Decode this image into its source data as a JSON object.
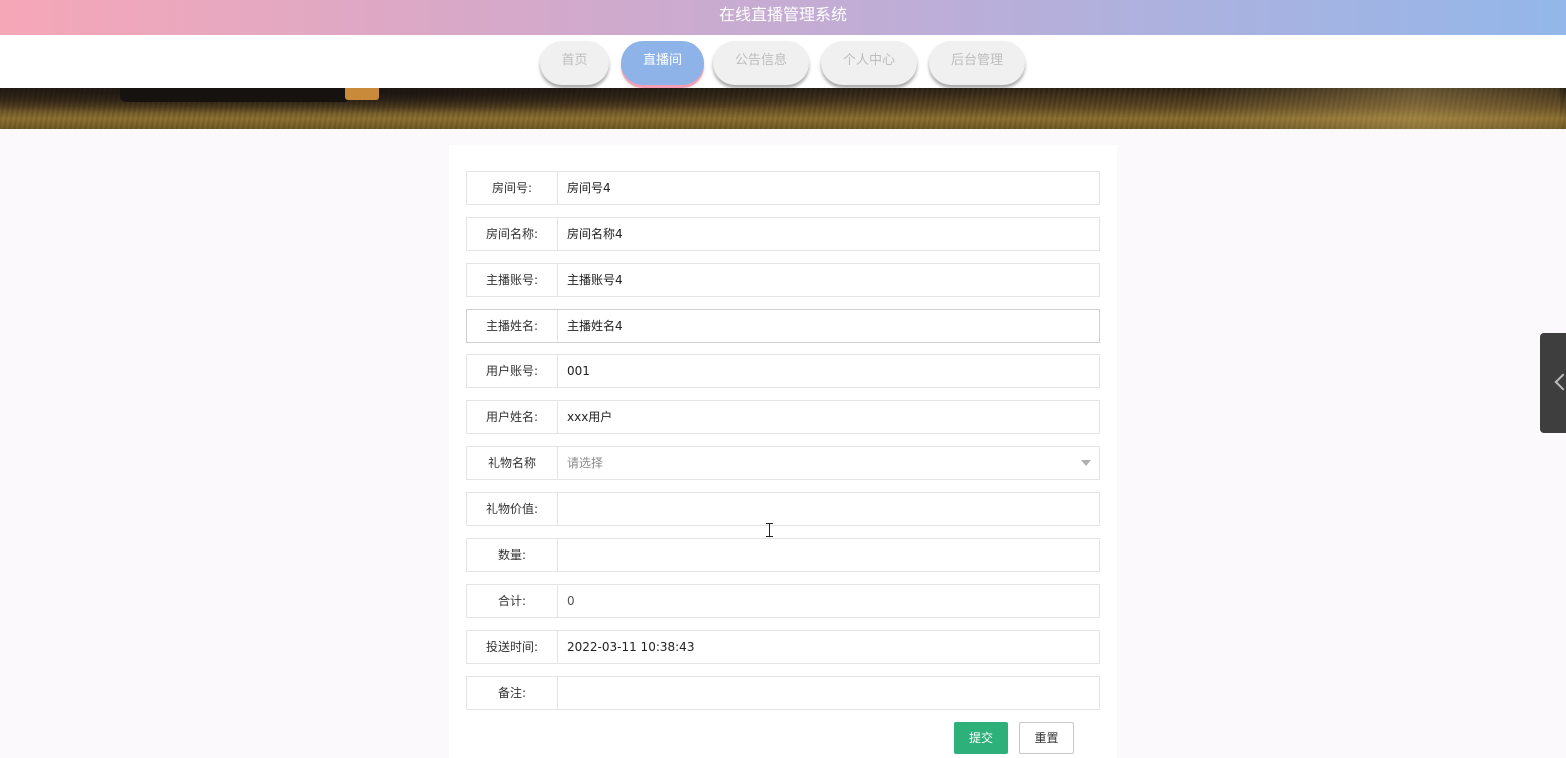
{
  "app": {
    "title": "在线直播管理系统"
  },
  "nav": {
    "items": [
      {
        "label": "首页",
        "active": false
      },
      {
        "label": "直播间",
        "active": true
      },
      {
        "label": "公告信息",
        "active": false
      },
      {
        "label": "个人中心",
        "active": false
      },
      {
        "label": "后台管理",
        "active": false
      }
    ]
  },
  "form": {
    "fields": [
      {
        "label": "房间号:",
        "value": "房间号4"
      },
      {
        "label": "房间名称:",
        "value": "房间名称4"
      },
      {
        "label": "主播账号:",
        "value": "主播账号4"
      },
      {
        "label": "主播姓名:",
        "value": "主播姓名4"
      },
      {
        "label": "用户账号:",
        "value": "001"
      },
      {
        "label": "用户姓名:",
        "value": "xxx用户"
      },
      {
        "label": "礼物名称",
        "value": "",
        "placeholder": "请选择",
        "type": "select"
      },
      {
        "label": "礼物价值:",
        "value": ""
      },
      {
        "label": "数量:",
        "value": ""
      },
      {
        "label": "合计:",
        "value": "0"
      },
      {
        "label": "投送时间:",
        "value": "2022-03-11 10:38:43"
      },
      {
        "label": "备注:",
        "value": ""
      }
    ],
    "submit_label": "提交",
    "reset_label": "重置"
  },
  "colors": {
    "header_gradient_start": "#f6a7b7",
    "header_gradient_end": "#93b7ea",
    "nav_active": "#8db3e8",
    "nav_active_underline": "#f3a0b6",
    "submit_button": "#2db07a"
  },
  "icons": {
    "select_caret": "chevron-down-icon",
    "side_handle": "chevron-left-icon"
  }
}
